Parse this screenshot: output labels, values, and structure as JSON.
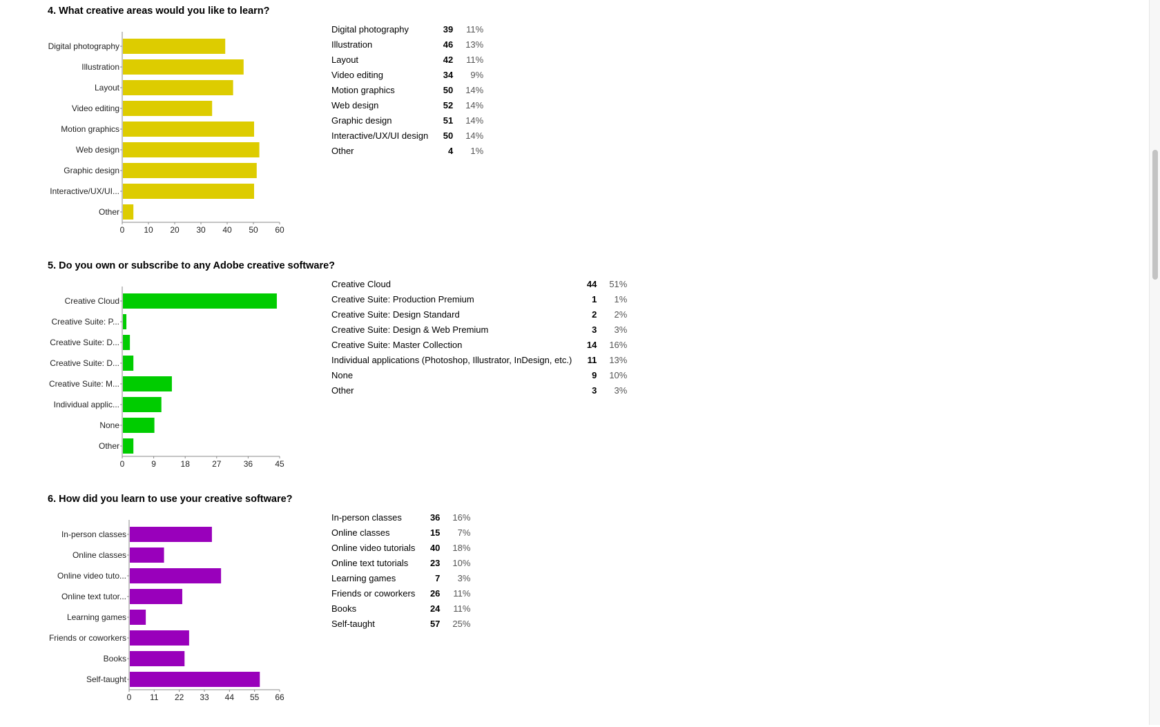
{
  "questions": [
    {
      "title": "4. What creative areas would you like to learn?",
      "color": "#ddcc00",
      "rows": [
        {
          "label": "Digital photography",
          "count": "39",
          "pct": "11%"
        },
        {
          "label": "Illustration",
          "count": "46",
          "pct": "13%"
        },
        {
          "label": "Layout",
          "count": "42",
          "pct": "11%"
        },
        {
          "label": "Video editing",
          "count": "34",
          "pct": "9%"
        },
        {
          "label": "Motion graphics",
          "count": "50",
          "pct": "14%"
        },
        {
          "label": "Web design",
          "count": "52",
          "pct": "14%"
        },
        {
          "label": "Graphic design",
          "count": "51",
          "pct": "14%"
        },
        {
          "label": "Interactive/UX/UI design",
          "count": "50",
          "pct": "14%"
        },
        {
          "label": "Other",
          "count": "4",
          "pct": "1%"
        }
      ]
    },
    {
      "title": "5. Do you own or subscribe to any Adobe creative software?",
      "color": "#00cc00",
      "rows": [
        {
          "label": "Creative Cloud",
          "count": "44",
          "pct": "51%"
        },
        {
          "label": "Creative Suite: Production Premium",
          "count": "1",
          "pct": "1%"
        },
        {
          "label": "Creative Suite: Design Standard",
          "count": "2",
          "pct": "2%"
        },
        {
          "label": "Creative Suite: Design & Web Premium",
          "count": "3",
          "pct": "3%"
        },
        {
          "label": "Creative Suite: Master Collection",
          "count": "14",
          "pct": "16%"
        },
        {
          "label": "Individual applications (Photoshop, Illustrator, InDesign, etc.)",
          "count": "11",
          "pct": "13%"
        },
        {
          "label": "None",
          "count": "9",
          "pct": "10%"
        },
        {
          "label": "Other",
          "count": "3",
          "pct": "3%"
        }
      ]
    },
    {
      "title": "6. How did you learn to use your creative software?",
      "color": "#9900bb",
      "rows": [
        {
          "label": "In-person classes",
          "count": "36",
          "pct": "16%"
        },
        {
          "label": "Online classes",
          "count": "15",
          "pct": "7%"
        },
        {
          "label": "Online video tutorials",
          "count": "40",
          "pct": "18%"
        },
        {
          "label": "Online text tutorials",
          "count": "23",
          "pct": "10%"
        },
        {
          "label": "Learning games",
          "count": "7",
          "pct": "3%"
        },
        {
          "label": "Friends or coworkers",
          "count": "26",
          "pct": "11%"
        },
        {
          "label": "Books",
          "count": "24",
          "pct": "11%"
        },
        {
          "label": "Self-taught",
          "count": "57",
          "pct": "25%"
        }
      ]
    }
  ],
  "chart_data": [
    {
      "type": "bar",
      "orientation": "horizontal",
      "categories": [
        "Digital photography",
        "Illustration",
        "Layout",
        "Video editing",
        "Motion graphics",
        "Web design",
        "Graphic design",
        "Interactive/UX/UI...",
        "Other"
      ],
      "values": [
        39,
        46,
        42,
        34,
        50,
        52,
        51,
        50,
        4
      ],
      "xlim": [
        0,
        60
      ],
      "xticks": [
        "0",
        "10",
        "20",
        "30",
        "40",
        "50",
        "60"
      ],
      "grid": false,
      "color": "#ddcc00"
    },
    {
      "type": "bar",
      "orientation": "horizontal",
      "categories": [
        "Creative Cloud",
        "Creative Suite: P...",
        "Creative Suite: D...",
        "Creative Suite: D...",
        "Creative Suite: M...",
        "Individual applic...",
        "None",
        "Other"
      ],
      "values": [
        44,
        1,
        2,
        3,
        14,
        11,
        9,
        3
      ],
      "xlim": [
        0,
        45
      ],
      "xticks": [
        "0",
        "9",
        "18",
        "27",
        "36",
        "45"
      ],
      "grid": false,
      "color": "#00cc00"
    },
    {
      "type": "bar",
      "orientation": "horizontal",
      "categories": [
        "In-person classes",
        "Online classes",
        "Online video tuto...",
        "Online text tutor...",
        "Learning games",
        "Friends or coworkers",
        "Books",
        "Self-taught"
      ],
      "values": [
        36,
        15,
        40,
        23,
        7,
        26,
        24,
        57
      ],
      "xlim": [
        0,
        66
      ],
      "xticks": [
        "0",
        "11",
        "22",
        "33",
        "44",
        "55",
        "66"
      ],
      "grid": false,
      "color": "#9900bb"
    }
  ]
}
